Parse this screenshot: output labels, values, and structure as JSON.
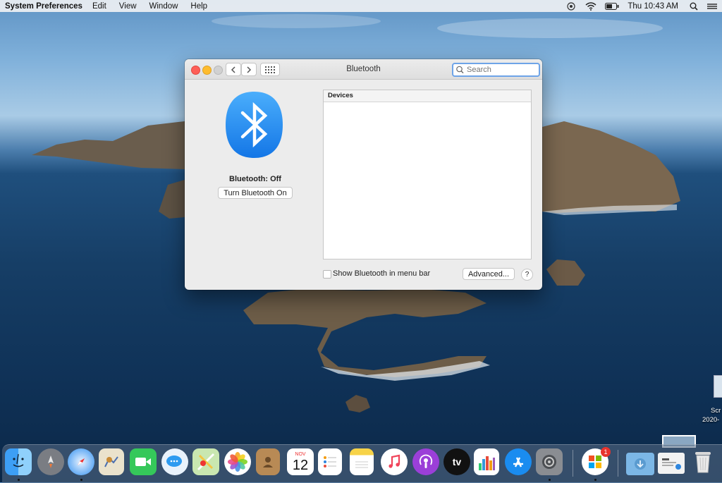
{
  "menubar": {
    "app_name": "System Preferences",
    "items": [
      "Edit",
      "View",
      "Window",
      "Help"
    ],
    "clock": "Thu 10:43 AM",
    "icons": [
      "airplay-icon",
      "wifi-icon",
      "battery-icon",
      "spotlight-icon"
    ]
  },
  "window": {
    "title": "Bluetooth",
    "search_placeholder": "Search",
    "bluetooth_status": "Bluetooth: Off",
    "turn_on_label": "Turn Bluetooth On",
    "devices_header": "Devices",
    "show_in_menu_bar_label": "Show Bluetooth in menu bar",
    "show_in_menu_bar_checked": false,
    "advanced_label": "Advanced...",
    "help_label": "?"
  },
  "desktop": {
    "file_label_1": "Scr",
    "file_label_2": "2020-"
  },
  "dock": {
    "items": [
      "Finder",
      "Launchpad",
      "Safari",
      "Mail",
      "FaceTime",
      "Messages",
      "Maps",
      "Photos",
      "Contacts",
      "Calendar",
      "Reminders",
      "Notes",
      "Music",
      "Podcasts",
      "TV",
      "Numbers",
      "App Store",
      "System Preferences",
      "Microsoft AutoUpdate",
      "Downloads",
      "Screenshot",
      "Trash"
    ],
    "calendar_month": "NOV",
    "calendar_day": "12",
    "tv_label": "tv",
    "badge_count": "1"
  },
  "colors": {
    "bluetooth_blue": "#1a8cf0",
    "close": "#fe5f57",
    "minimize": "#febc2e",
    "zoom": "#d1d1d1"
  }
}
